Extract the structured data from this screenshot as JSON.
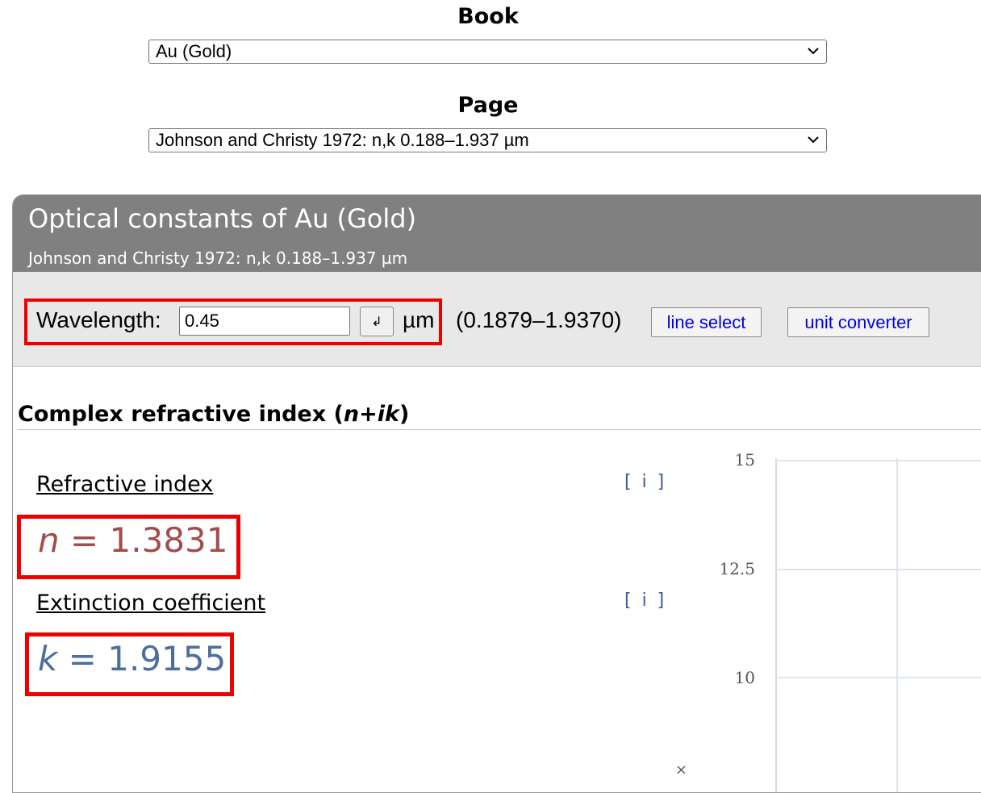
{
  "book": {
    "label": "Book",
    "selected": "Au (Gold)",
    "chevron": "chevron-down-icon"
  },
  "page": {
    "label": "Page",
    "selected": "Johnson and Christy 1972: n,k 0.188–1.937 µm",
    "chevron": "chevron-down-icon"
  },
  "panel": {
    "title": "Optical constants of Au (Gold)",
    "subtitle": "Johnson and Christy 1972: n,k 0.188–1.937 µm"
  },
  "controls": {
    "wavelength_label": "Wavelength:",
    "wavelength_value": "0.45",
    "enter_glyph": "↲",
    "unit": "µm",
    "range": "(0.1879–1.9370)",
    "line_select": "line select",
    "unit_converter": "unit converter"
  },
  "section": {
    "title_main": "Complex refractive index (",
    "title_expr": "n+ik",
    "title_close": ")"
  },
  "refractive": {
    "label": "Refractive index",
    "info": "[ i ]",
    "var": "n",
    "eq": " = ",
    "value": "1.3831",
    "color": "#a24c4c"
  },
  "extinction": {
    "label": "Extinction coefficient",
    "info": "[ i ]",
    "var": "k",
    "eq": " = ",
    "value": "1.9155",
    "color": "#4a6f9e"
  },
  "chart_data": {
    "type": "line",
    "y_ticks": [
      "15",
      "12.5",
      "10"
    ],
    "partial_tick": "×",
    "grid": true
  },
  "colors": {
    "highlight": "#ee0000",
    "header_bg": "#808080",
    "link": "#0000ee"
  }
}
